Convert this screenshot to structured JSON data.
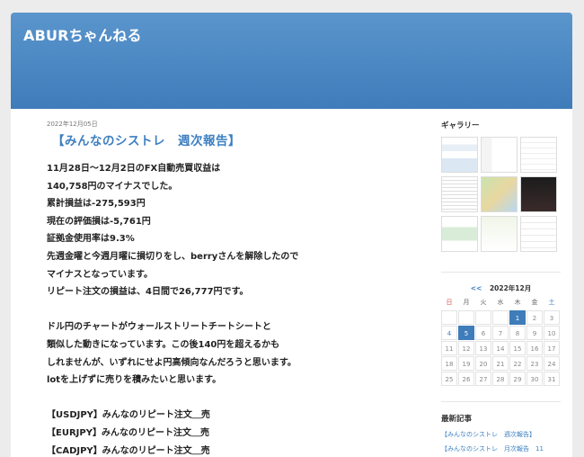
{
  "site": {
    "title": "ABURちゃんねる"
  },
  "post": {
    "date": "2022年12月05日",
    "title": "【みんなのシストレ　週次報告】",
    "lines": [
      "11月28日〜12月2日のFX自動売買収益は",
      "140,758円のマイナスでした。",
      "累計損益は-275,593円",
      "現在の評価損は-5,761円",
      "証拠金使用率は9.3%",
      "先週金曜と今週月曜に損切りをし、berryさんを解除したので",
      "マイナスとなっています。",
      "リピート注文の損益は、4日間で26,777円です。",
      "",
      "ドル円のチャートがウォールストリートチートシートと",
      "類似した動きになっています。この後140円を超えるかも",
      "しれませんが、いずれにせよ円高傾向なんだろうと思います。",
      "lotを上げずに売りを積みたいと思います。",
      "",
      "【USDJPY】みんなのリピート注文＿売",
      "【EURJPY】みんなのリピート注文＿売",
      "【CADJPY】みんなのリピート注文＿売"
    ]
  },
  "sidebar": {
    "gallery_heading": "ギャラリー",
    "calendar": {
      "prev": "<<",
      "month": "2022年12月",
      "weekdays": [
        "日",
        "月",
        "火",
        "水",
        "木",
        "金",
        "土"
      ],
      "weeks": [
        [
          "",
          "",
          "",
          "",
          "1",
          "2",
          "3"
        ],
        [
          "4",
          "5",
          "6",
          "7",
          "8",
          "9",
          "10"
        ],
        [
          "11",
          "12",
          "13",
          "14",
          "15",
          "16",
          "17"
        ],
        [
          "18",
          "19",
          "20",
          "21",
          "22",
          "23",
          "24"
        ],
        [
          "25",
          "26",
          "27",
          "28",
          "29",
          "30",
          "31"
        ]
      ],
      "highlighted": [
        "1",
        "5"
      ],
      "linked": [
        "4"
      ]
    },
    "recent_heading": "最新記事",
    "recent_items": [
      "【みんなのシストレ　週次報告】",
      "【みんなのシストレ　月次報告　11"
    ]
  }
}
